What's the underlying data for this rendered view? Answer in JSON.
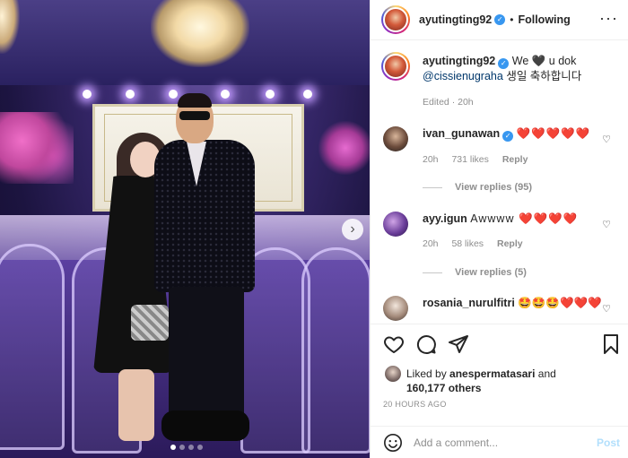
{
  "post": {
    "username": "ayutingting92",
    "follow_status": "Following",
    "caption_text": "We 🖤 u dok",
    "caption_mention": "@cissienugraha",
    "caption_korean": "생일 축하합니다",
    "caption_meta": "Edited · 20h",
    "icons": {
      "verified": "verified-badge-icon",
      "more": "more-options-icon",
      "like": "heart-outline-icon",
      "comment": "comment-bubble-icon",
      "share": "paper-plane-icon",
      "save": "bookmark-icon",
      "emoji": "smiley-face-icon",
      "next": "chevron-right-icon"
    }
  },
  "comments": [
    {
      "username": "ivan_gunawan",
      "verified": true,
      "text": "❤️❤️❤️❤️❤️",
      "time": "20h",
      "likes": "731 likes",
      "reply_label": "Reply",
      "view_replies": "View replies (95)"
    },
    {
      "username": "ayy.igun",
      "verified": false,
      "text": "Awwww ❤️❤️❤️❤️",
      "time": "20h",
      "likes": "58 likes",
      "reply_label": "Reply",
      "view_replies": "View replies (5)"
    },
    {
      "username": "rosania_nurulfitri",
      "verified": false,
      "text": "🤩🤩🤩❤️❤️❤️",
      "time": "",
      "likes": "",
      "reply_label": "",
      "view_replies": ""
    }
  ],
  "liked_by": {
    "prefix": "Liked by",
    "user": "anespermatasari",
    "and": "and",
    "count": "160,177 others"
  },
  "timestamp": "20 HOURS AGO",
  "add_comment": {
    "placeholder": "Add a comment...",
    "post_label": "Post"
  },
  "carousel": {
    "total_slides": 4,
    "active_slide": 1
  },
  "colors": {
    "verified": "#3897f0",
    "heart_red": "#ed4956",
    "post_disabled": "#b2dffc",
    "meta_gray": "#8e8e8e"
  }
}
